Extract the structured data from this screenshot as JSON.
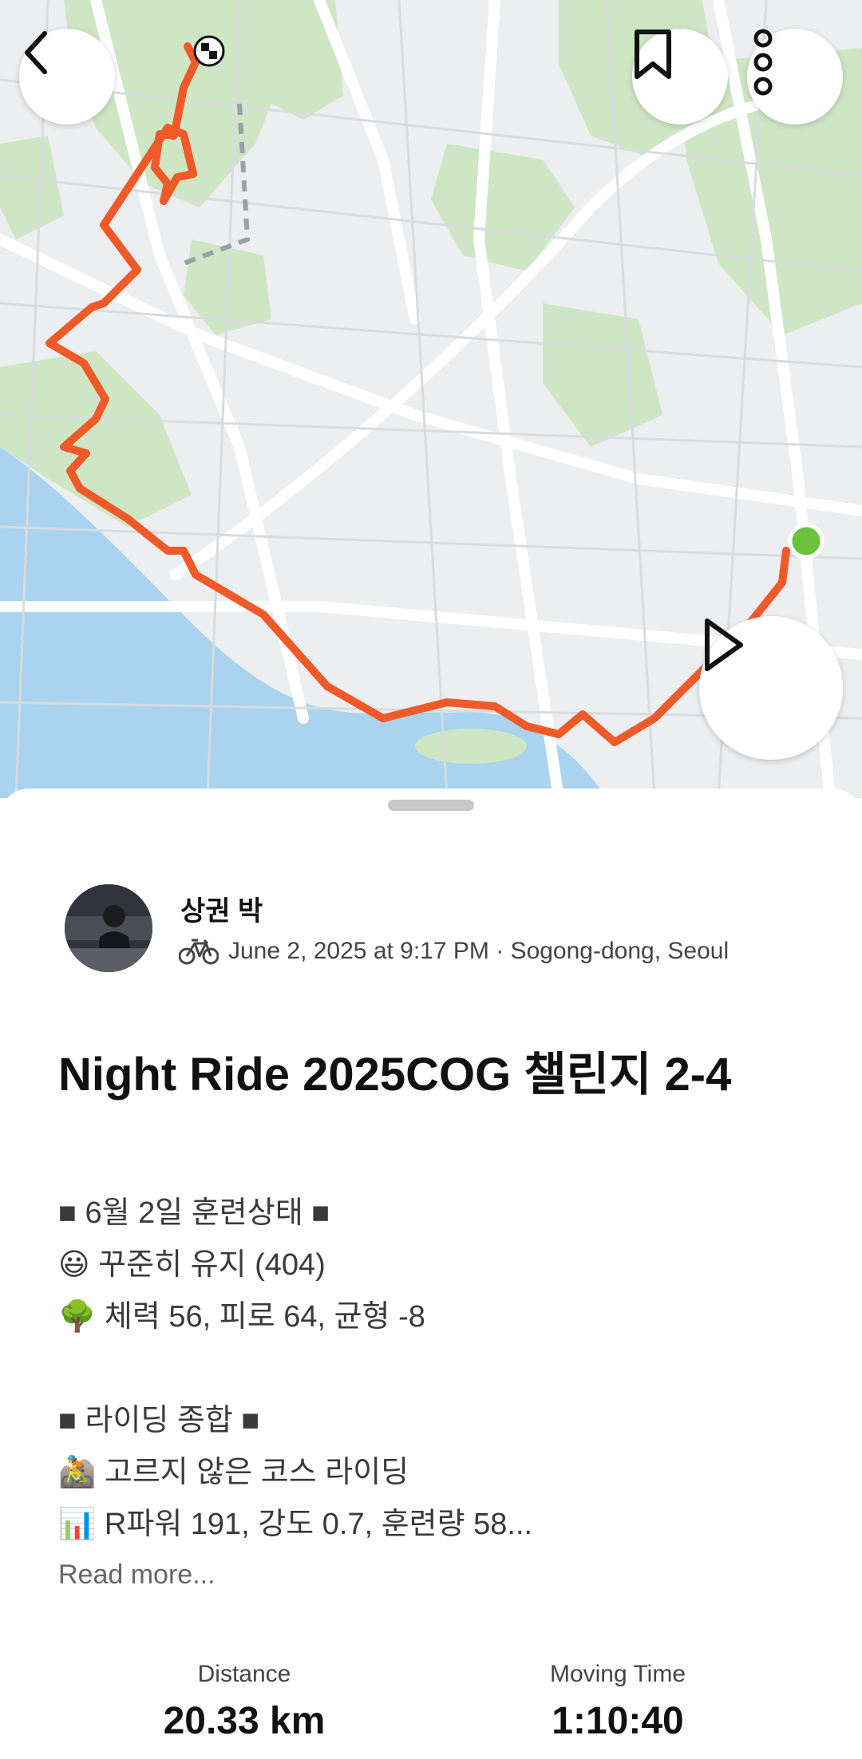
{
  "map": {
    "back_icon": "chevron-left-icon",
    "bookmark_icon": "bookmark-icon",
    "more_icon": "more-vertical-icon",
    "play_icon": "play-icon",
    "route_color": "#f05a28",
    "start_color": "#6cc43c"
  },
  "athlete": {
    "name": "상권 박",
    "activity_icon": "bike-icon",
    "meta": "June 2, 2025 at 9:17 PM · Sogong-dong, Seoul"
  },
  "activity": {
    "title": "Night Ride 2025COG 챌린지 2-4",
    "description": "■ 6월 2일 훈련상태 ■\n😃 꾸준히 유지 (404)\n🌳 체력 56, 피로 64, 균형 -8\n\n■ 라이딩 종합 ■\n🚵 고르지 않은 코스 라이딩\n📊 R파워 191, 강도 0.7, 훈련량 58...",
    "read_more": "Read more..."
  },
  "stats": {
    "distance_label": "Distance",
    "distance_value": "20.33 km",
    "time_label": "Moving Time",
    "time_value": "1:10:40"
  }
}
